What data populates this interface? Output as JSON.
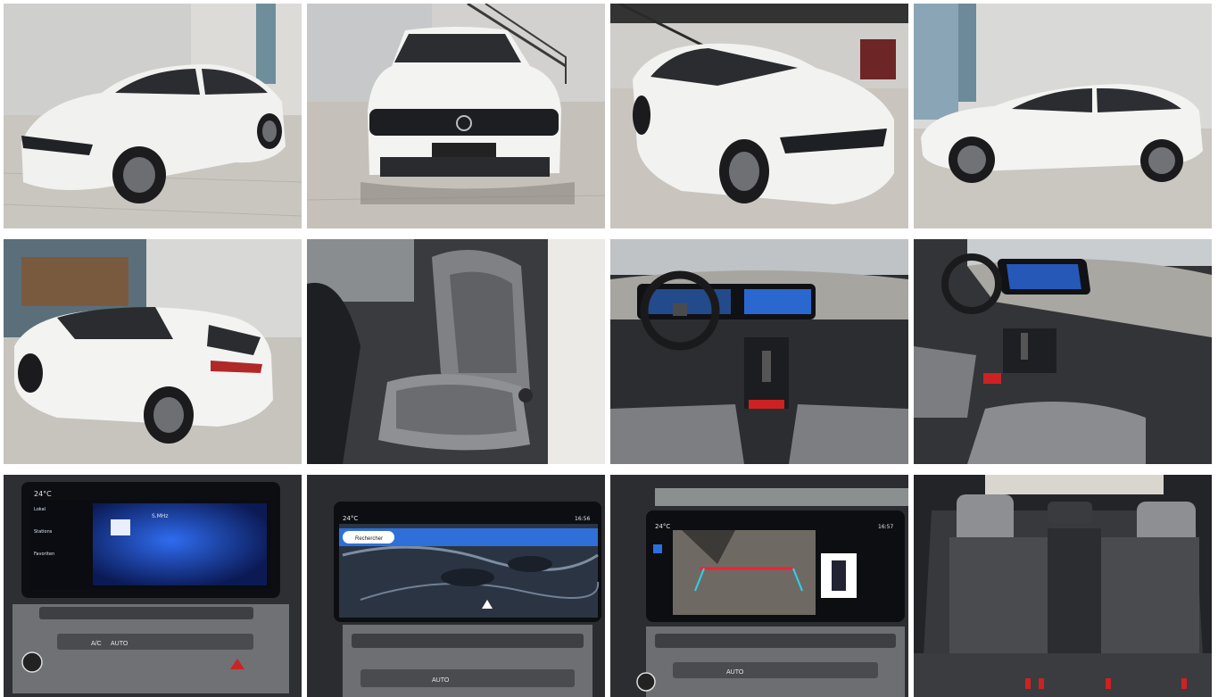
{
  "gallery": {
    "photos": [
      {
        "name": "photo-front-left-exterior"
      },
      {
        "name": "photo-front-exterior"
      },
      {
        "name": "photo-front-right-exterior"
      },
      {
        "name": "photo-side-exterior"
      },
      {
        "name": "photo-rear-left-exterior"
      },
      {
        "name": "photo-driver-seat"
      },
      {
        "name": "photo-dashboard"
      },
      {
        "name": "photo-center-console"
      },
      {
        "name": "photo-infotainment-radio"
      },
      {
        "name": "photo-infotainment-navigation"
      },
      {
        "name": "photo-rear-camera"
      },
      {
        "name": "photo-rear-seats"
      }
    ]
  },
  "screens": {
    "temperature": "24°C",
    "radio": {
      "menu": [
        "Lokal",
        "Stations",
        "Favoriten"
      ],
      "station": "S.MHz"
    },
    "navigation": {
      "search_label": "Rechercher",
      "clock": "16:56"
    },
    "camera": {
      "clock": "16:57"
    }
  },
  "buttons": {
    "auto_label": "AUTO",
    "ac_label": "A/C"
  },
  "colors": {
    "car_white": "#f1f1ef",
    "showroom_floor": "#c9c6c0",
    "screen_blue": "#1f58d8",
    "interior_dark": "#2a2b2e"
  }
}
